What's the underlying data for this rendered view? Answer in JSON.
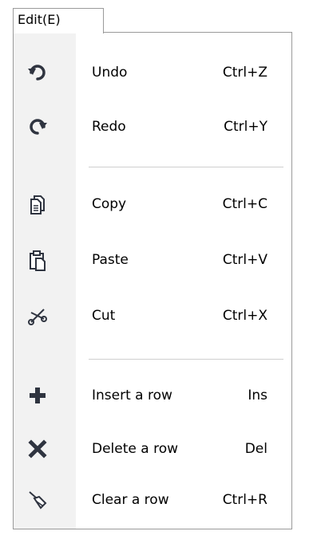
{
  "menu": {
    "title": "Edit(E)",
    "items": [
      {
        "label": "Undo",
        "shortcut": "Ctrl+Z",
        "icon": "undo-icon"
      },
      {
        "label": "Redo",
        "shortcut": "Ctrl+Y",
        "icon": "redo-icon"
      },
      {
        "label": "Copy",
        "shortcut": "Ctrl+C",
        "icon": "copy-icon"
      },
      {
        "label": "Paste",
        "shortcut": "Ctrl+V",
        "icon": "paste-icon"
      },
      {
        "label": "Cut",
        "shortcut": "Ctrl+X",
        "icon": "scissors-icon"
      },
      {
        "label": "Insert a row",
        "shortcut": "Ins",
        "icon": "plus-icon"
      },
      {
        "label": "Delete a row",
        "shortcut": "Del",
        "icon": "x-icon"
      },
      {
        "label": "Clear a row",
        "shortcut": "Ctrl+R",
        "icon": "broom-icon"
      }
    ]
  }
}
